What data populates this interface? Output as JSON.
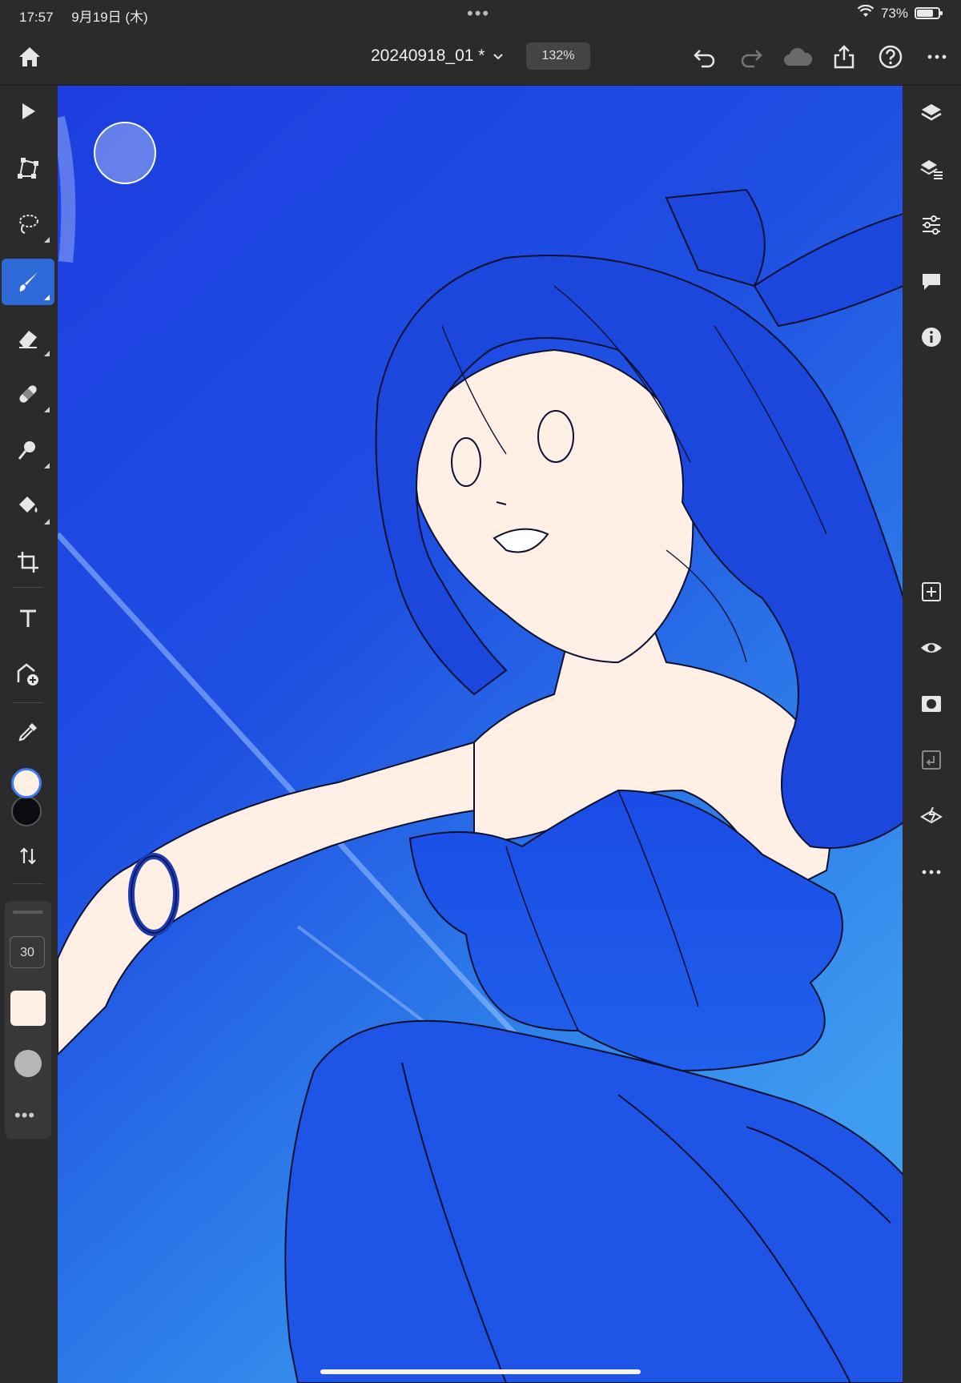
{
  "status": {
    "time": "17:57",
    "date": "9月19日 (木)",
    "battery": "73%"
  },
  "header": {
    "doc_title": "20240918_01 *",
    "zoom": "132%"
  },
  "brush": {
    "size": "30"
  },
  "colors": {
    "foreground": "#fff0e6",
    "background": "#0b0b12",
    "accent": "#2d6ad8"
  },
  "left_tools": [
    "select-tool",
    "transform-tool",
    "lasso-tool",
    "brush-tool",
    "eraser-tool",
    "healing-tool",
    "smudge-tool",
    "fill-tool",
    "crop-tool",
    "type-tool",
    "place-image-tool",
    "eyedropper-tool",
    "swap-colors"
  ],
  "right_tools": [
    "layers-icon",
    "layer-properties-icon",
    "adjustments-icon",
    "comments-icon",
    "info-icon",
    "add-layer-icon",
    "visibility-icon",
    "mask-icon",
    "clip-icon",
    "layer-style-icon",
    "more-icon"
  ]
}
